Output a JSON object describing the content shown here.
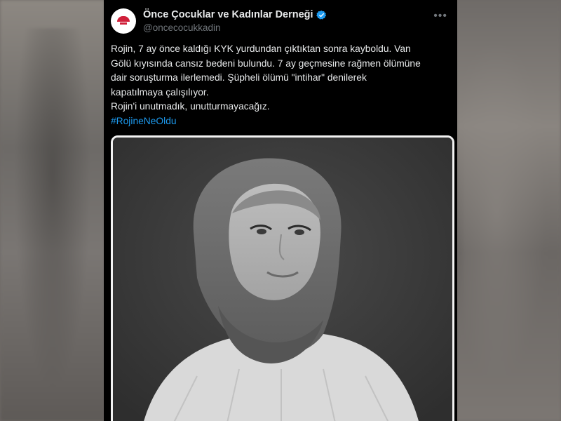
{
  "tweet": {
    "display_name": "Önce Çocuklar ve Kadınlar Derneği",
    "handle": "@oncecocukkadin",
    "more_icon": "more-horizontal-icon",
    "verified_icon": "verified-badge-icon",
    "lines": [
      "Rojin, 7 ay önce kaldığı KYK yurdundan çıktıktan sonra kayboldu. Van",
      "Gölü kıyısında cansız bedeni bulundu. 7 ay geçmesine rağmen ölümüne",
      "dair soruşturma ilerlemedi. Şüpheli ölümü \"intihar\" denilerek",
      "kapatılmaya çalışılıyor.",
      "Rojin'i unutmadık, unutturmayacağız."
    ],
    "hashtag": "#RojineNeOldu"
  },
  "colors": {
    "background": "#000000",
    "text": "#e7e9ea",
    "secondary": "#71767b",
    "link": "#1d9bf0",
    "verified": "#1d9bf0"
  }
}
